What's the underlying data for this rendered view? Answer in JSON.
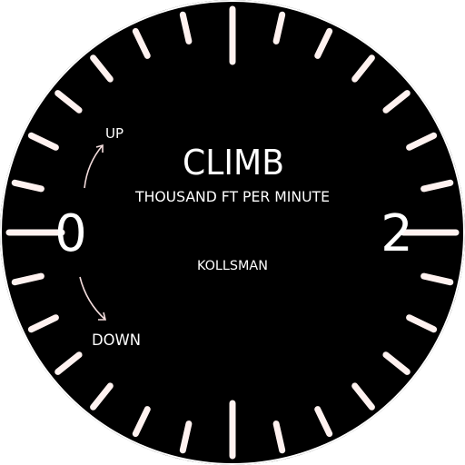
{
  "gauge": {
    "title": "CLIMB",
    "units": "THOUSAND FT PER MINUTE",
    "brand": "KOLLSMAN",
    "up_label": "UP",
    "down_label": "DOWN",
    "zero_label": "0",
    "two_label": "2",
    "tick_count": 28,
    "colors": {
      "background": "#000000",
      "markings": "#fff2f0",
      "bezel": "#ffffff"
    }
  }
}
